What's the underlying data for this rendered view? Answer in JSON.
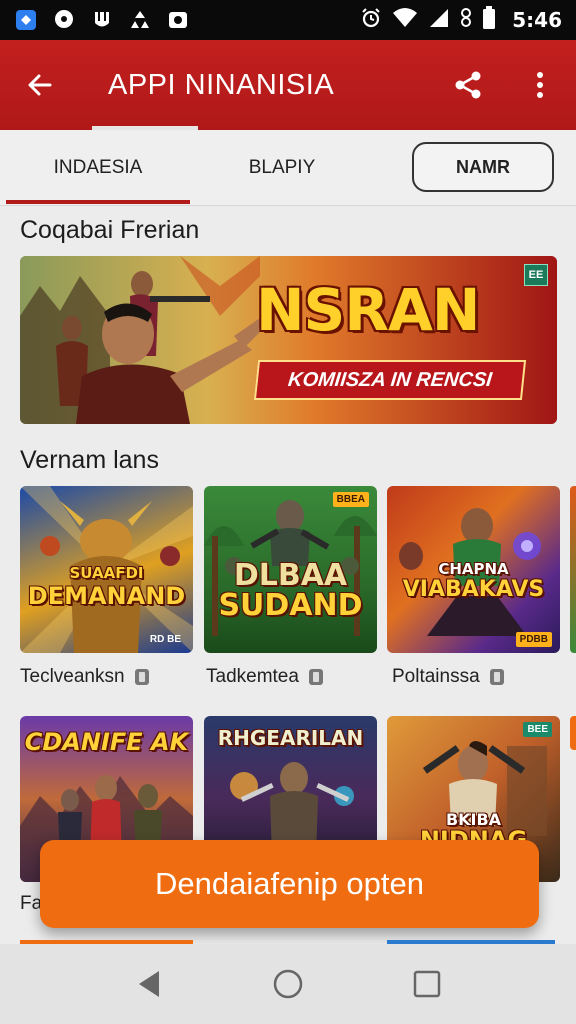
{
  "status_bar": {
    "time": "5:46",
    "left_icons": [
      "app-icon",
      "messenger-icon",
      "notification-icon",
      "recycle-icon",
      "photo-icon"
    ],
    "right_icons": [
      "alarm-icon",
      "wifi-icon",
      "signal-icon",
      "data-icon",
      "battery-icon"
    ]
  },
  "app_bar": {
    "title": "APPI NINANISIA",
    "back_icon": "arrow-left-icon",
    "share_icon": "share-icon",
    "more_icon": "more-vert-icon",
    "color": "#c2201f"
  },
  "tabs": {
    "items": [
      "INDAESIA",
      "BLAPIY"
    ],
    "active": "INDAESIA",
    "pill_label": "NAMR"
  },
  "featured": {
    "section_title": "Coqabai Frerian",
    "banner_headline": "NSRAN",
    "banner_subtitle": "KOMIISZA IN RENCSI",
    "banner_badge": "EE"
  },
  "games_section": {
    "section_title": "Vernam lans",
    "row1": [
      {
        "logo_top": "SUAAFDI",
        "logo_main": "DEMANAND",
        "corner": "RD BE",
        "name": "Teclveanksn"
      },
      {
        "logo_top": "DLBAA",
        "logo_main": "SUDAND",
        "corner": "BBEA",
        "name": "Tadkemtea"
      },
      {
        "logo_top": "CHAPNA",
        "logo_main": "VIABAKAVS",
        "corner": "PDBB",
        "name": "Poltainssa"
      }
    ],
    "row2": [
      {
        "logo_top": "CDANIFE AK"
      },
      {
        "logo_top": "RHGEARILAN"
      },
      {
        "logo_top": "BKIBA",
        "logo_main": "NIDNAG",
        "corner": "BEE"
      }
    ],
    "partial_name": "Fa"
  },
  "cta": {
    "label": "Dendaiafenip opten",
    "color": "#ef6c10"
  },
  "nav_bar": {
    "icons": [
      "back-triangle-icon",
      "home-circle-icon",
      "recents-square-icon"
    ]
  }
}
